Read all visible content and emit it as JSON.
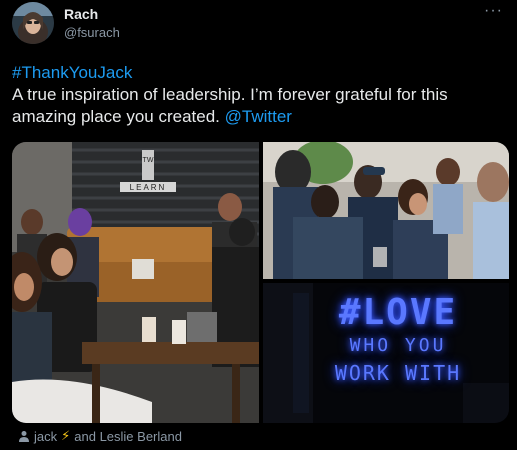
{
  "author": {
    "name": "Rach",
    "handle": "@fsurach",
    "avatar_icon": "avatar-image"
  },
  "tweet": {
    "hashtag": "#ThankYouJack",
    "text": "A true inspiration of leadership.  I’m forever grateful for this amazing place you created. ",
    "mention": "@Twitter"
  },
  "media": {
    "neon_line1": "#LOVE",
    "neon_line2": "WHO YOU",
    "neon_line3": "WORK WITH",
    "wall_letters": "TW",
    "wall_word": "LEARN"
  },
  "tags": {
    "user1": "jack",
    "emoji": "⚡",
    "rest": " and Leslie Berland"
  },
  "more_label": "···",
  "colors": {
    "background": "#000000",
    "text": "#e7e9ea",
    "secondary": "#8b98a5",
    "link": "#1d9bf0",
    "neon": "#3d5cff"
  }
}
